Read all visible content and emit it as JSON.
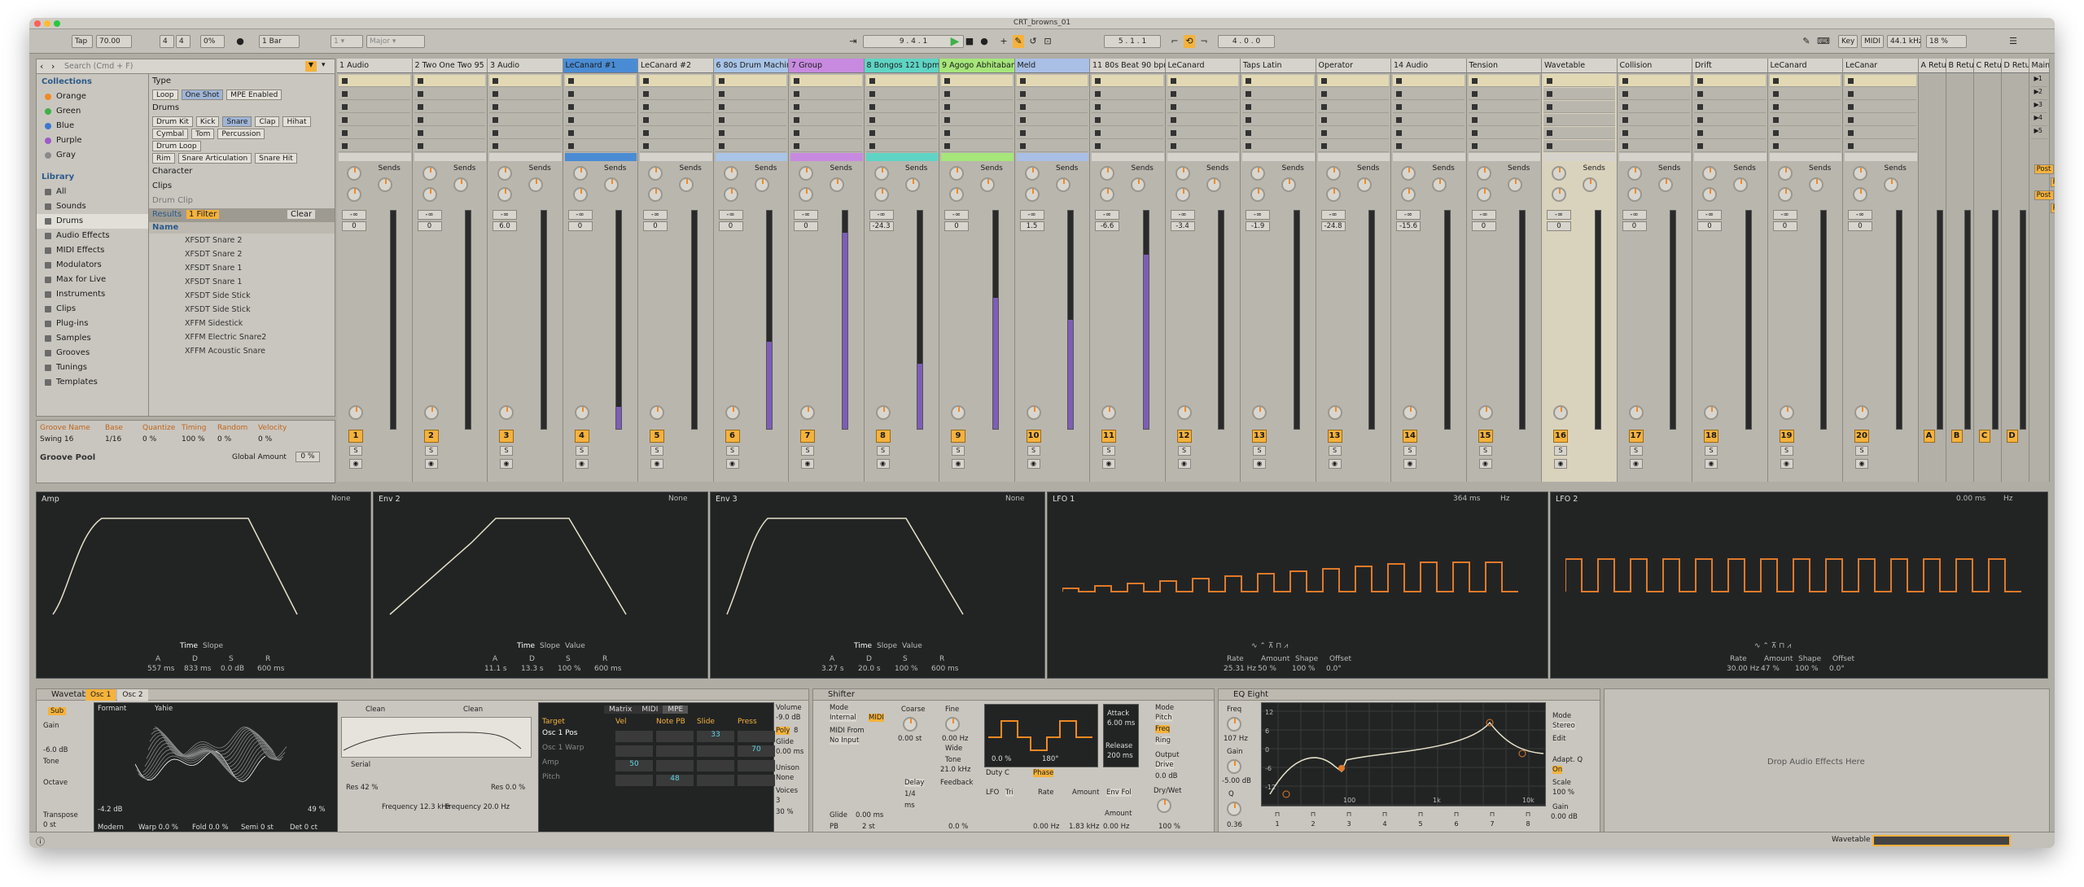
{
  "window": {
    "title": "CRT_browns_01"
  },
  "control_bar": {
    "tap": "Tap",
    "tempo": "70.00",
    "sig_num": "4",
    "sig_den": "4",
    "pct": "0%",
    "quant": "1 Bar",
    "arr_pos": "9 . 4 . 1",
    "loop_start": "5 . 1 . 1",
    "loop_len": "4 . 0 . 0",
    "key": "Key",
    "midi": "MIDI",
    "sample_rate": "44.1 kHz",
    "cpu": "18 %"
  },
  "browser": {
    "search_placeholder": "Search (Cmd + F)",
    "collections_title": "Collections",
    "collections": [
      {
        "label": "Orange",
        "color": "#f08a24"
      },
      {
        "label": "Green",
        "color": "#3fb04a"
      },
      {
        "label": "Blue",
        "color": "#3a78d0"
      },
      {
        "label": "Purple",
        "color": "#9d5bc8"
      },
      {
        "label": "Gray",
        "color": "#8a8a8a"
      }
    ],
    "library_title": "Library",
    "library": [
      "All",
      "Sounds",
      "Drums",
      "Audio Effects",
      "MIDI Effects",
      "Modulators",
      "Max for Live",
      "Instruments",
      "Clips",
      "Plug-ins",
      "Samples",
      "Grooves",
      "Tunings",
      "Templates"
    ],
    "selected_library": "Drums",
    "filter_type": "Type",
    "filter_type_opts": [
      "Loop",
      "One Shot",
      "MPE Enabled"
    ],
    "filter_drums": "Drums",
    "drum_tags_row1": [
      "Drum Kit",
      "Kick",
      "Snare",
      "Clap",
      "Hihat"
    ],
    "drum_tags_row2": [
      "Cymbal",
      "Tom",
      "Percussion"
    ],
    "drum_tags_row3": [
      "Drum Loop"
    ],
    "snare_tags": [
      "Rim",
      "Snare Articulation",
      "Snare Hit"
    ],
    "filter_character": "Character",
    "filter_clips": "Clips",
    "filter_drumclip": "Drum Clip",
    "results_label": "Results",
    "results_filter": "1 Filter",
    "clear_label": "Clear",
    "name_header": "Name",
    "results": [
      "XFSDT Snare 2",
      "XFSDT Snare 2",
      "XFSDT Snare 1",
      "XFSDT Snare 1",
      "XFSDT Side Stick",
      "XFSDT Side Stick",
      "XFFM Sidestick",
      "XFFM Electric Snare2",
      "XFFM Acoustic Snare"
    ]
  },
  "groove": {
    "headers": [
      "Groove Name",
      "Base",
      "Quantize",
      "Timing",
      "Random",
      "Velocity"
    ],
    "row": [
      "Swing 16",
      "1/16",
      "0 %",
      "100 %",
      "0 %",
      "0 %"
    ],
    "pool": "Groove Pool",
    "global_amount_label": "Global Amount",
    "global_amount": "0 %"
  },
  "tracks": [
    {
      "name": "1 Audio",
      "color": "#d6d3cc",
      "num": "1",
      "vol": "0"
    },
    {
      "name": "2 Two One Two 95 b",
      "color": "#d6d3cc",
      "num": "2",
      "vol": "0"
    },
    {
      "name": "3 Audio",
      "color": "#d6d3cc",
      "num": "3",
      "vol": "6.0"
    },
    {
      "name": "LeCanard #1",
      "color": "#4a8cd4",
      "num": "4",
      "vol": "0"
    },
    {
      "name": "LeCanard #2",
      "color": "#d6d3cc",
      "num": "5",
      "vol": "0"
    },
    {
      "name": "6 80s Drum Machin",
      "color": "#a9c4e6",
      "num": "6",
      "vol": "0"
    },
    {
      "name": "7 Group",
      "color": "#c88ae0",
      "num": "7",
      "vol": "0"
    },
    {
      "name": "8 Bongos 121 bpm",
      "color": "#5fd4c4",
      "num": "8",
      "vol": "-24.3"
    },
    {
      "name": "9 Agogo Abhitabant",
      "color": "#a6e67a",
      "num": "9",
      "vol": "0"
    },
    {
      "name": "Meld",
      "color": "#a9bfe6",
      "num": "10",
      "vol": "1.5"
    },
    {
      "name": "11 80s Beat 90 bpm",
      "color": "#d6d3cc",
      "num": "11",
      "vol": "-6.6"
    },
    {
      "name": "LeCanard",
      "color": "#d6d3cc",
      "num": "12",
      "vol": "-3.4"
    },
    {
      "name": "Taps Latin",
      "color": "#d6d3cc",
      "num": "13",
      "vol": "-1.9"
    },
    {
      "name": "Operator",
      "color": "#d6d3cc",
      "num": "13",
      "vol": "-24.8"
    },
    {
      "name": "14 Audio",
      "color": "#d6d3cc",
      "num": "14",
      "vol": "-15.6"
    },
    {
      "name": "Tension",
      "color": "#d6d3cc",
      "num": "15",
      "vol": "0"
    },
    {
      "name": "Wavetable",
      "color": "#d6d3cc",
      "num": "16",
      "vol": "0"
    },
    {
      "name": "Collision",
      "color": "#d6d3cc",
      "num": "17",
      "vol": "0"
    },
    {
      "name": "Drift",
      "color": "#d6d3cc",
      "num": "18",
      "vol": "0"
    },
    {
      "name": "LeCanard",
      "color": "#d6d3cc",
      "num": "19",
      "vol": "0"
    },
    {
      "name": "LeCanar",
      "color": "#d6d3cc",
      "num": "20",
      "vol": "0"
    }
  ],
  "returns": [
    {
      "name": "A Retu",
      "num": "A"
    },
    {
      "name": "B Retu",
      "num": "B"
    },
    {
      "name": "C Retu",
      "num": "C"
    },
    {
      "name": "D Retu",
      "num": "D"
    }
  ],
  "main": {
    "name": "Main",
    "scenes": [
      "1",
      "2",
      "3",
      "4",
      "5"
    ],
    "post_label": "Post"
  },
  "sends_label": "Sends",
  "envs": [
    {
      "title": "Amp",
      "mode": "None",
      "tabs": [
        "Time",
        "Slope"
      ],
      "labels": [
        "A",
        "D",
        "S",
        "R"
      ],
      "values": [
        "557 ms",
        "833 ms",
        "0.0 dB",
        "600 ms"
      ]
    },
    {
      "title": "Env 2",
      "mode": "None",
      "tabs": [
        "Time",
        "Slope",
        "Value"
      ],
      "labels": [
        "A",
        "D",
        "S",
        "R"
      ],
      "values": [
        "11.1 s",
        "13.3 s",
        "100 %",
        "600 ms"
      ]
    },
    {
      "title": "Env 3",
      "mode": "None",
      "tabs": [
        "Time",
        "Slope",
        "Value"
      ],
      "labels": [
        "A",
        "D",
        "S",
        "R"
      ],
      "values": [
        "3.27 s",
        "20.0 s",
        "100 %",
        "600 ms"
      ]
    }
  ],
  "lfos": [
    {
      "title": "LFO 1",
      "rate_hdr": "364 ms",
      "hz": "Hz",
      "labels": [
        "Rate",
        "Amount",
        "Shape",
        "Offset"
      ],
      "values": [
        "25.31 Hz",
        "50 %",
        "100 %",
        "0.0°"
      ]
    },
    {
      "title": "LFO 2",
      "rate_hdr": "0.00 ms",
      "hz": "Hz",
      "labels": [
        "Rate",
        "Amount",
        "Shape",
        "Offset"
      ],
      "values": [
        "30.00 Hz",
        "47 %",
        "100 %",
        "0.0°"
      ]
    }
  ],
  "wavetable": {
    "title": "Wavetable",
    "osc_tabs": [
      "Osc 1",
      "Osc 2"
    ],
    "formant": "Formant",
    "yahie": "Yahie",
    "gain_lbl": "Gain",
    "gain": "-6.0 dB",
    "tone_lbl": "Tone",
    "tone": "0.0",
    "octave_lbl": "Octave",
    "transpose": "Transpose",
    "transpose_val": "0 st",
    "modern": "Modern",
    "warp": "Warp 0.0 %",
    "fold": "Fold 0.0 %",
    "semi": "Semi 0 st",
    "det": "Det 0 ct",
    "db_val": "-4.2 dB",
    "pct49": "49 %",
    "filter1": "Clean",
    "filter2": "Clean",
    "serial": "Serial",
    "res1": "Res 42 %",
    "freq1": "Frequency 12.3 kHz",
    "freq2": "Frequency 20.0 Hz",
    "res2": "Res 0.0 %",
    "matrix_tabs": [
      "Matrix",
      "MIDI",
      "MPE"
    ],
    "mat_headers": [
      "Target",
      "Vel",
      "Note PB",
      "Slide",
      "Press"
    ],
    "mat_rows": [
      "Osc 1 Pos",
      "Osc 1 Warp",
      "Amp",
      "Pitch"
    ],
    "mat_vals": [
      "33",
      "50",
      "48",
      "70"
    ],
    "volume_lbl": "Volume",
    "volume": "-9.0 dB",
    "poly": "Poly",
    "poly_n": "8",
    "glide_lbl": "Glide",
    "glide": "0.00 ms",
    "unison_lbl": "Unison",
    "unison": "None",
    "voices_lbl": "Voices",
    "voices": "3",
    "amount": "30 %"
  },
  "shifter": {
    "title": "Shifter",
    "mode": "Mode",
    "internal": "Internal",
    "midi": "MIDI",
    "midi_from": "MIDI From",
    "no_input": "No Input",
    "coarse": "Coarse",
    "fine": "Fine",
    "coarse_v": "0.00 st",
    "fine_v": "0.00 Hz",
    "wide": "Wide",
    "tone": "Tone",
    "tone_v": "21.0 kHz",
    "delay": "Delay",
    "frac": "1/4",
    "ms": "ms",
    "feedback": "Feedback",
    "fb_v": "0.0 %",
    "lfo": "LFO",
    "tri": "Tri",
    "duty": "Duty C",
    "duty_v": "0.0 %",
    "phase": "Phase",
    "phase_v": "180°",
    "rate": "Rate",
    "rate_v": "0.00 Hz",
    "amount": "Amount",
    "amount_v": "1.83 kHz",
    "glide": "Glide",
    "glide_v": "0.00 ms",
    "pb": "PB",
    "pb_v": "2 st",
    "attack": "Attack",
    "attack_v": "6.00 ms",
    "release": "Release",
    "release_v": "200 ms",
    "envfol": "Env Fol",
    "ef_amount": "Amount",
    "ef_v": "0.00 Hz",
    "freq_lbl": "Freq",
    "ring_lbl": "Ring",
    "pitch_lbl": "Pitch",
    "output": "Output",
    "drive": "Drive",
    "drive_v": "0.0 dB",
    "drywet": "Dry/Wet",
    "dw_v": "100 %"
  },
  "eq": {
    "title": "EQ Eight",
    "freq": "Freq",
    "freq_v": "107 Hz",
    "gain": "Gain",
    "gain_v": "-5.00 dB",
    "q": "Q",
    "q_v": "0.36",
    "mode_lbl": "Mode",
    "mode": "Stereo",
    "edit": "Edit",
    "adapt": "Adapt. Q",
    "on": "On",
    "scale": "Scale",
    "scale_v": "100 %",
    "gain2": "Gain",
    "gain2_v": "0.00 dB",
    "bands": [
      "1",
      "2",
      "3",
      "4",
      "5",
      "6",
      "7",
      "8"
    ],
    "axis_y": [
      "12",
      "6",
      "0",
      "-6",
      "-12"
    ],
    "axis_x": [
      "100",
      "1k",
      "10k"
    ]
  },
  "drop_hint": "Drop Audio Effects Here",
  "status": {
    "device": "Wavetable"
  }
}
